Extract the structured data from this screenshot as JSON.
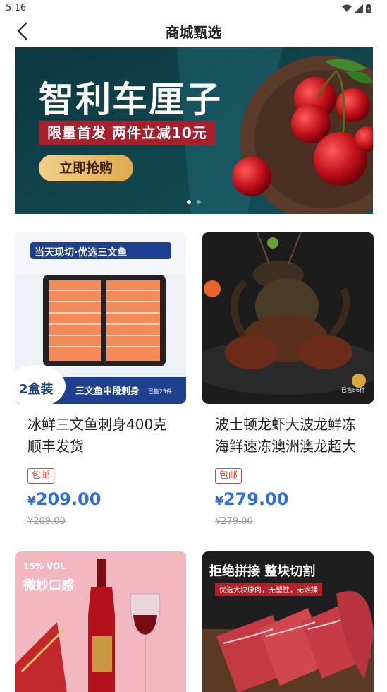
{
  "status": {
    "time": "5:16"
  },
  "nav": {
    "title": "商城甄选",
    "back_icon": "chevron-left-icon"
  },
  "banner": {
    "title": "智利车厘子",
    "subtitle": "限量首发 两件立减10元",
    "button": "立即抢购",
    "slide_count": 2,
    "active_slide": 1
  },
  "products": [
    {
      "name": "冰鲜三文鱼刺身400克顺丰发货",
      "tag": "包邮",
      "price_symbol": "¥",
      "price": "209.00",
      "old_price": "¥209.00",
      "image_texts": {
        "top_banner": "当天现切·优选三文鱼",
        "badge": "2盒装",
        "bottom": "三文鱼中段刺身",
        "sold": "已售25件"
      }
    },
    {
      "name": "波士顿龙虾大波龙鲜冻海鲜速冻澳洲澳龙超大",
      "tag": "包邮",
      "price_symbol": "¥",
      "price": "279.00",
      "old_price": "¥279.00",
      "image_texts": {
        "sold": "已售86件"
      }
    },
    {
      "name": "",
      "image_texts": {
        "headline": "15% VOL",
        "sub": "微妙口感"
      }
    },
    {
      "name": "",
      "image_texts": {
        "headline": "拒绝拼接 整块切割",
        "sub": "优选大块原肉，无塑性，无滚揉"
      }
    }
  ],
  "colors": {
    "price": "#2f6fd3",
    "tag": "#e0443b",
    "banner_bg": "#0f3d45",
    "banner_sub_bg": "#a8202c"
  }
}
